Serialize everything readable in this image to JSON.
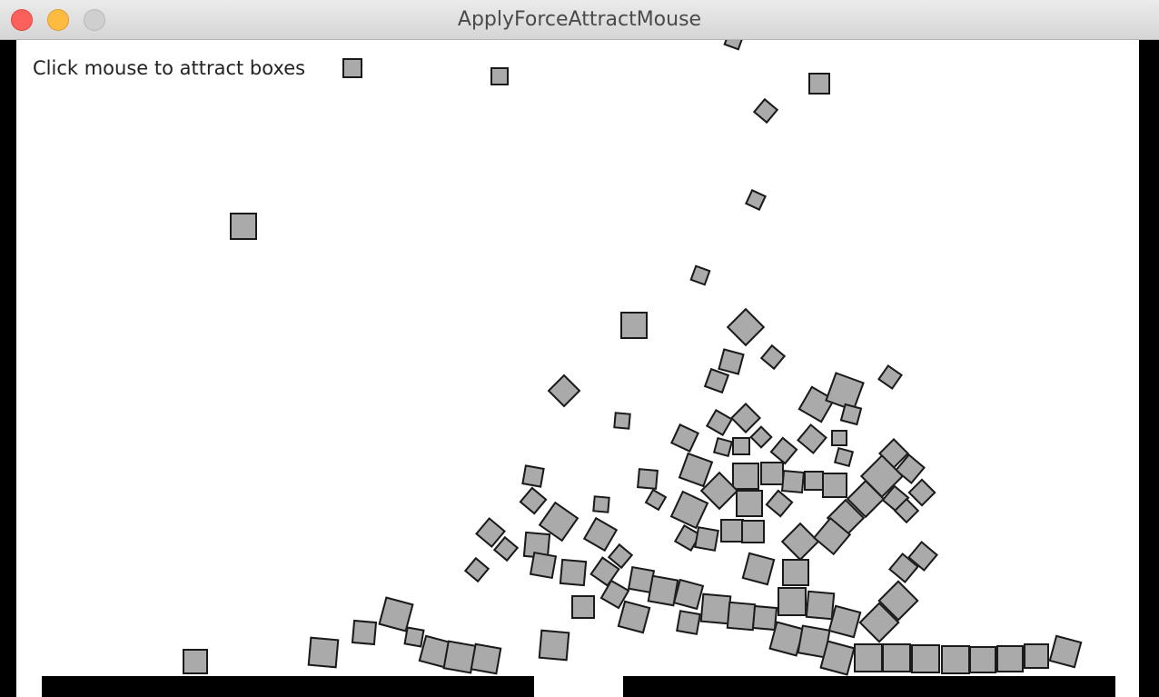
{
  "window": {
    "title": "ApplyForceAttractMouse"
  },
  "canvas": {
    "instructions": "Click mouse to attract boxes"
  },
  "colors": {
    "box_fill": "#aaaaaa",
    "box_border": "#1a1a1a",
    "ground": "#000000",
    "background": "#ffffff"
  }
}
